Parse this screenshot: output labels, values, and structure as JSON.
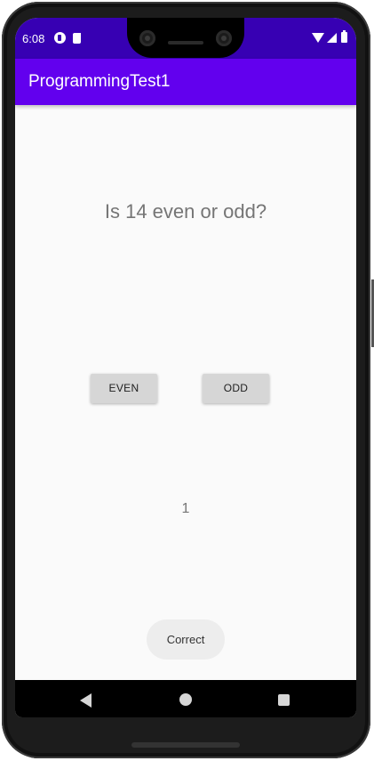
{
  "status_bar": {
    "time": "6:08",
    "icons": [
      "notification-app-icon",
      "sd-card-icon",
      "wifi-icon",
      "signal-icon",
      "battery-icon"
    ]
  },
  "app_bar": {
    "title": "ProgrammingTest1"
  },
  "main": {
    "question": "Is 14 even or odd?",
    "buttons": {
      "even_label": "EVEN",
      "odd_label": "ODD"
    },
    "score": "1"
  },
  "toast": {
    "message": "Correct"
  },
  "navigation": {
    "icons": [
      "back-icon",
      "home-icon",
      "recents-icon"
    ]
  },
  "colors": {
    "status_bar": "#3700b3",
    "app_bar": "#6200ee",
    "background": "#fafafa",
    "button": "#d6d6d6",
    "text_secondary": "#757575"
  }
}
